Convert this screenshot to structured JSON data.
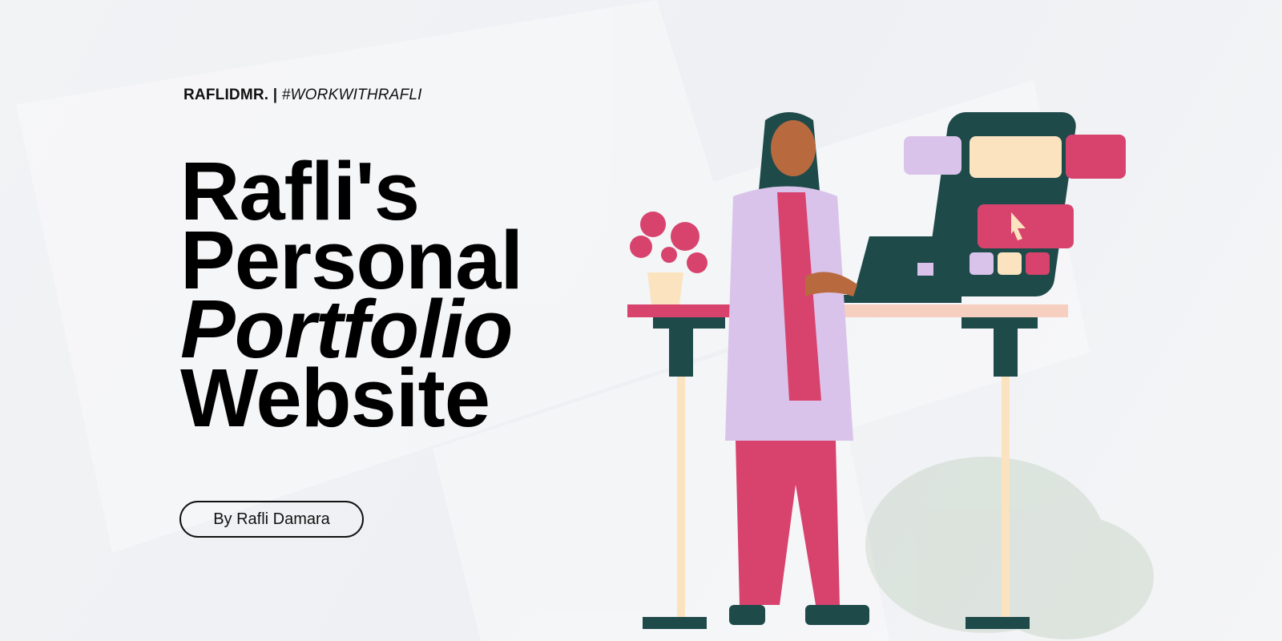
{
  "header": {
    "brand": "RAFLIDMR. |",
    "hashtag": "#WORKWITHRAFLI"
  },
  "title": {
    "line1": "Rafli's",
    "line2": "Personal",
    "line3": "Portfolio",
    "line4": "Website"
  },
  "byline": "By Rafli Damara",
  "colors": {
    "pink": "#d8436e",
    "teal": "#1f4a4a",
    "lilac": "#d9c3ea",
    "cream": "#fbe3c0"
  }
}
